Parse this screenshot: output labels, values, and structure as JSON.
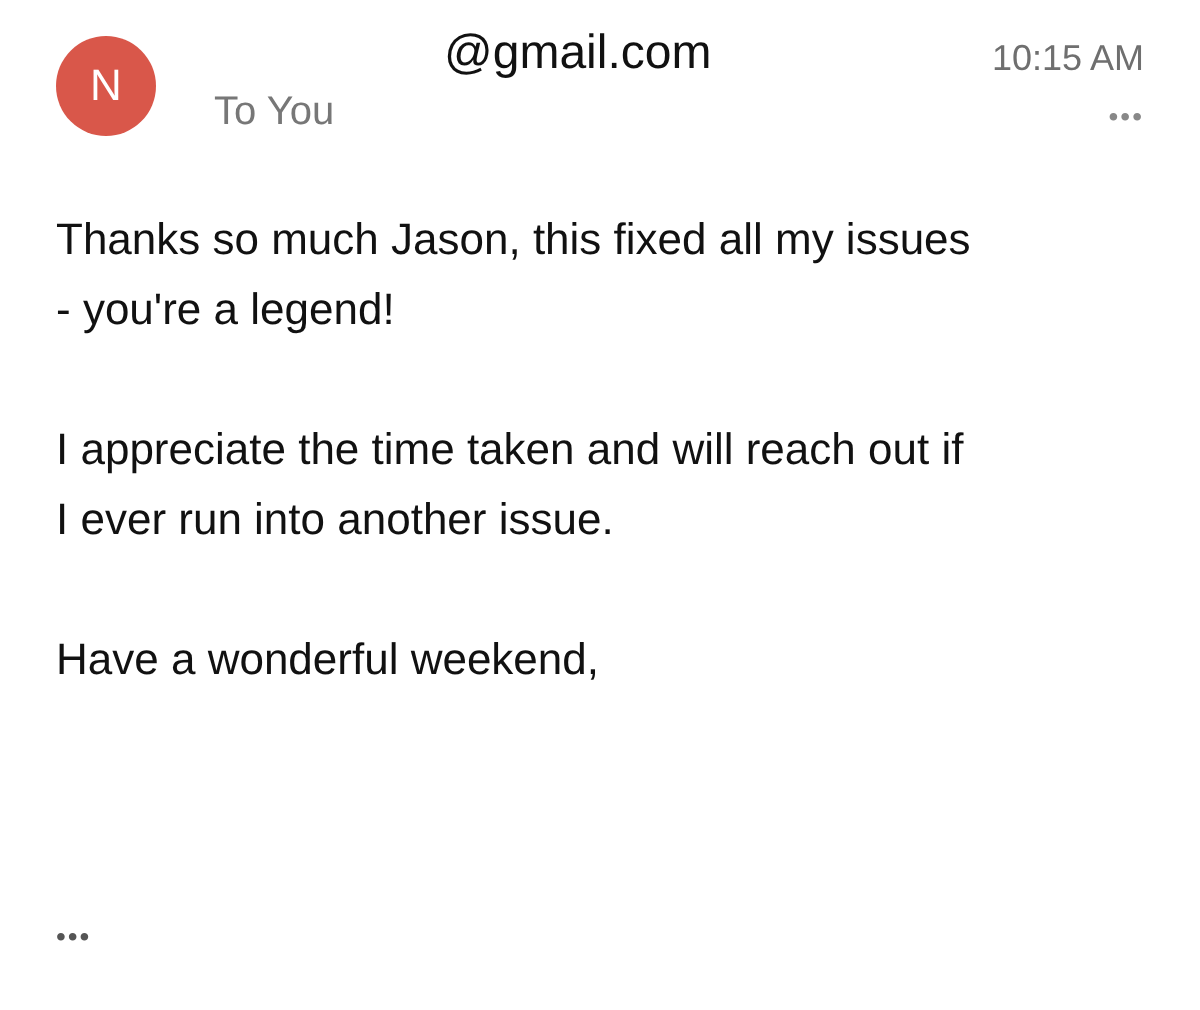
{
  "message": {
    "avatar_initial": "N",
    "sender": "@gmail.com",
    "recipient": "To You",
    "time": "10:15 AM",
    "more": "•••"
  },
  "body": [
    "Thanks so much Jason, this fixed all my issues\n- you're a legend!",
    "I appreciate the time taken and will reach out if\nI ever run into another issue.",
    "Have a wonderful weekend,"
  ],
  "trimmed": "•••"
}
